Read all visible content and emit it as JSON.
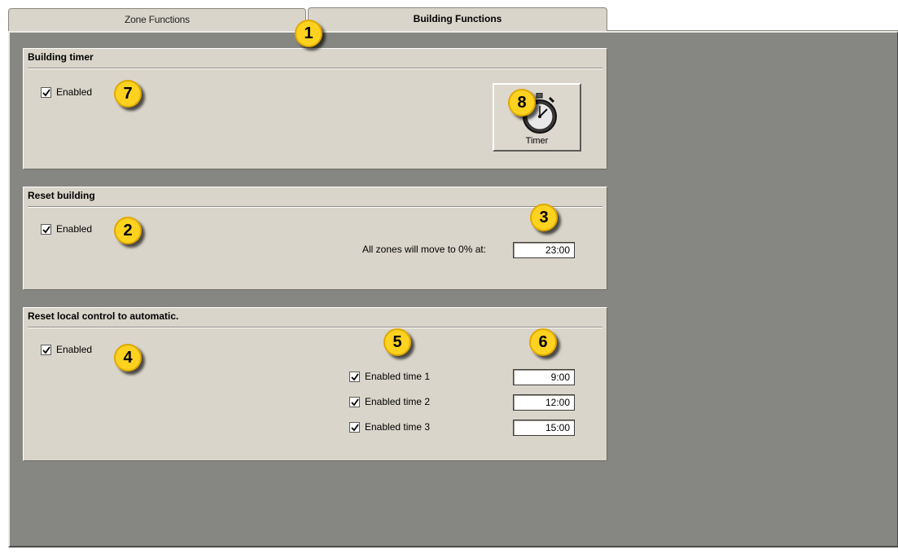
{
  "tabs": [
    {
      "label": "Zone Functions",
      "active": false
    },
    {
      "label": "Building Functions",
      "active": true
    }
  ],
  "building_timer": {
    "title": "Building timer",
    "enabled_label": "Enabled",
    "enabled": true,
    "timer_button_label": "Timer"
  },
  "reset_building": {
    "title": "Reset building",
    "enabled_label": "Enabled",
    "enabled": true,
    "zones_label": "All zones will move to 0% at:",
    "time": "23:00"
  },
  "reset_local": {
    "title": "Reset local control to automatic.",
    "enabled_label": "Enabled",
    "enabled": true,
    "times": [
      {
        "label": "Enabled time 1",
        "checked": true,
        "value": "9:00"
      },
      {
        "label": "Enabled time 2",
        "checked": true,
        "value": "12:00"
      },
      {
        "label": "Enabled time 3",
        "checked": true,
        "value": "15:00"
      }
    ]
  },
  "callouts": [
    "1",
    "2",
    "3",
    "4",
    "5",
    "6",
    "7",
    "8"
  ],
  "colors": {
    "panel_bg": "#d9d5ca",
    "main_bg": "#868683",
    "callout_yellow": "#ffd21f"
  }
}
